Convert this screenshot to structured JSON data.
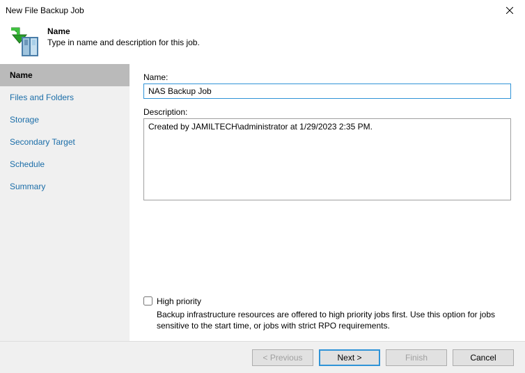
{
  "window": {
    "title": "New File Backup Job"
  },
  "header": {
    "title": "Name",
    "subtitle": "Type in name and description for this job."
  },
  "sidebar": {
    "items": [
      {
        "label": "Name",
        "selected": true
      },
      {
        "label": "Files and Folders",
        "selected": false
      },
      {
        "label": "Storage",
        "selected": false
      },
      {
        "label": "Secondary Target",
        "selected": false
      },
      {
        "label": "Schedule",
        "selected": false
      },
      {
        "label": "Summary",
        "selected": false
      }
    ]
  },
  "form": {
    "nameLabel": "Name:",
    "nameValue": "NAS Backup Job",
    "descriptionLabel": "Description:",
    "descriptionValue": "Created by JAMILTECH\\administrator at 1/29/2023 2:35 PM.",
    "highPriorityLabel": "High priority",
    "highPriorityDesc": "Backup infrastructure resources are offered to high priority jobs first. Use this option for jobs sensitive to the start time, or jobs with strict RPO requirements.",
    "highPriorityChecked": false
  },
  "buttons": {
    "previous": "< Previous",
    "next": "Next >",
    "finish": "Finish",
    "cancel": "Cancel"
  }
}
